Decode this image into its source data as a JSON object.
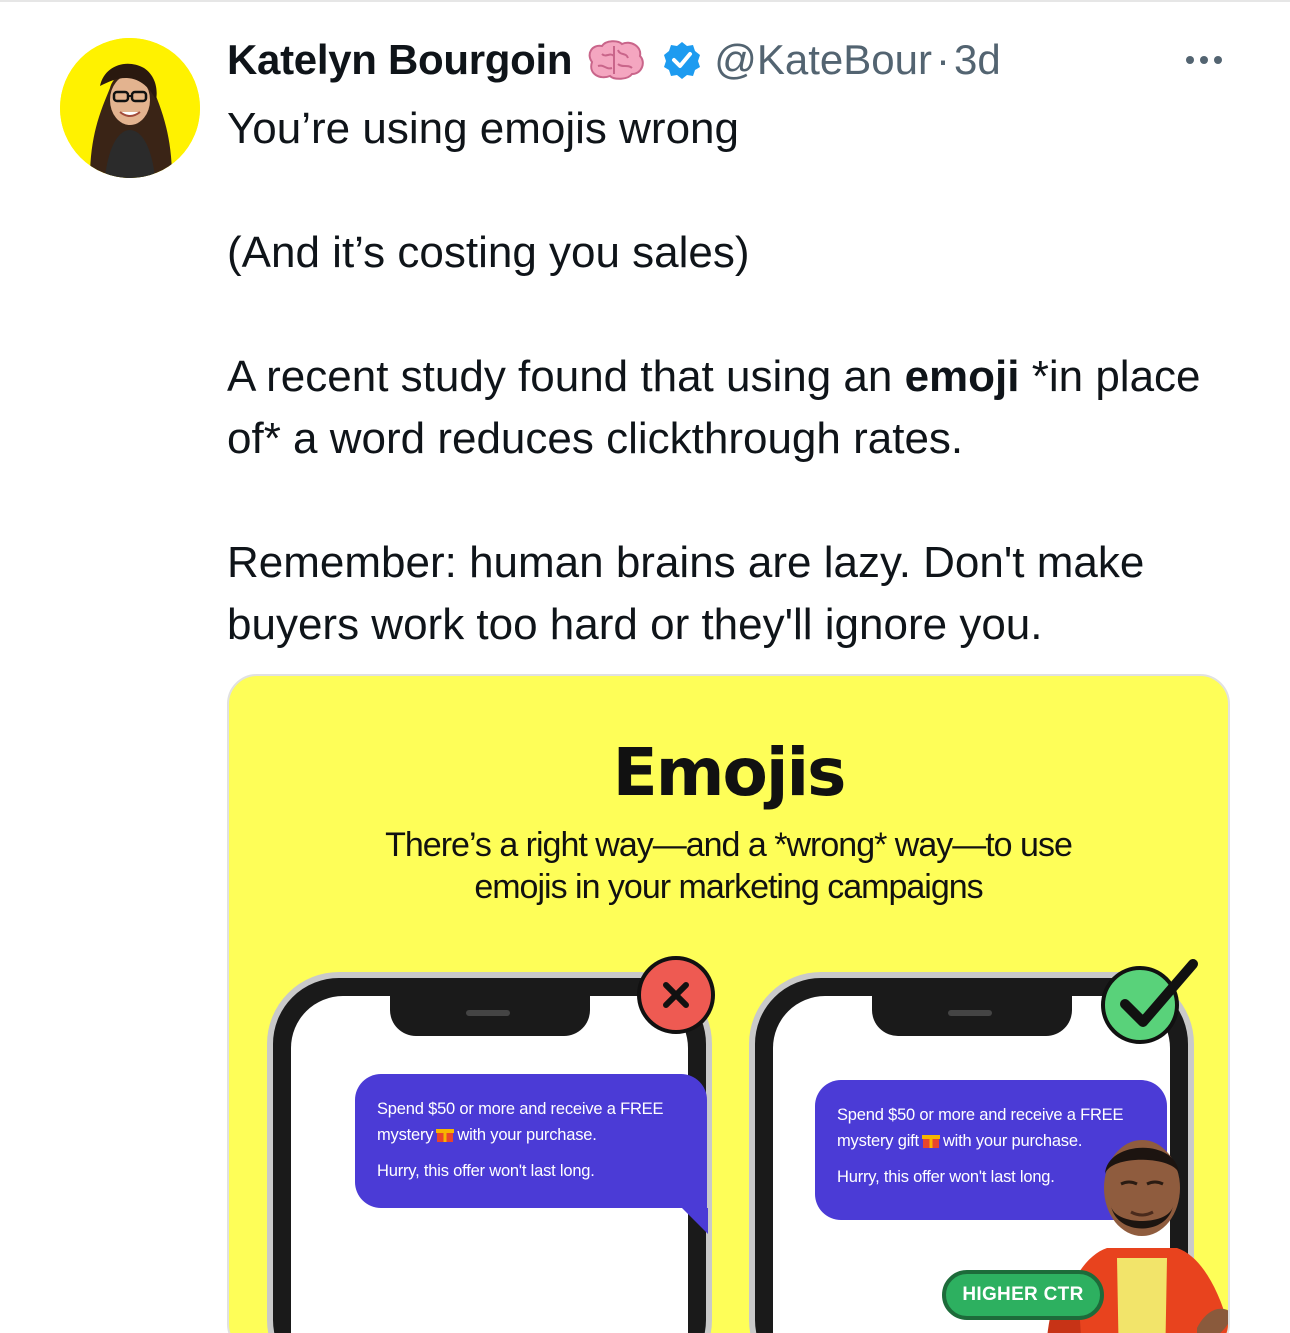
{
  "tweet": {
    "author_name": "Katelyn Bourgoin",
    "handle": "@KateBour",
    "separator": "·",
    "time": "3d",
    "text": {
      "line1": "You’re using emojis wrong",
      "line2": "(And it’s costing you sales)",
      "line3_pre": "A recent study found that using an ",
      "line3_bold": "emoji",
      "line3_post": " *in place of* a word reduces clickthrough rates.",
      "line4": "Remember: human brains are lazy. Don't make buyers work too hard or they'll ignore you."
    },
    "icons": {
      "avatar": "avatar-photo",
      "name_emoji": "brain-icon",
      "verified": "verified-badge-icon",
      "more": "more-options-icon"
    },
    "colors": {
      "verified": "#1d9bf0",
      "secondary_text": "#536471",
      "avatar_bg": "#fff200"
    }
  },
  "media": {
    "background": "#fefe58",
    "title": "Emojis",
    "subtitle_line1": "There’s a right way—and a *wrong* way—to use",
    "subtitle_line2": "emojis in your marketing campaigns",
    "left_phone": {
      "msg_a": "Spend $50 or more and receive a FREE",
      "msg_b_pre": "mystery",
      "msg_b_post": "with your purchase.",
      "msg_c": "Hurry, this offer won't last long.",
      "status_icon": "x-icon"
    },
    "right_phone": {
      "msg_a": "Spend $50 or more and receive a FREE",
      "msg_b_pre": "mystery gift",
      "msg_b_post": "with your purchase.",
      "msg_c": "Hurry, this offer won't last long.",
      "status_icon": "check-icon"
    },
    "ctr_label": "HIGHER CTR",
    "bubble_color": "#4b3bd6"
  }
}
